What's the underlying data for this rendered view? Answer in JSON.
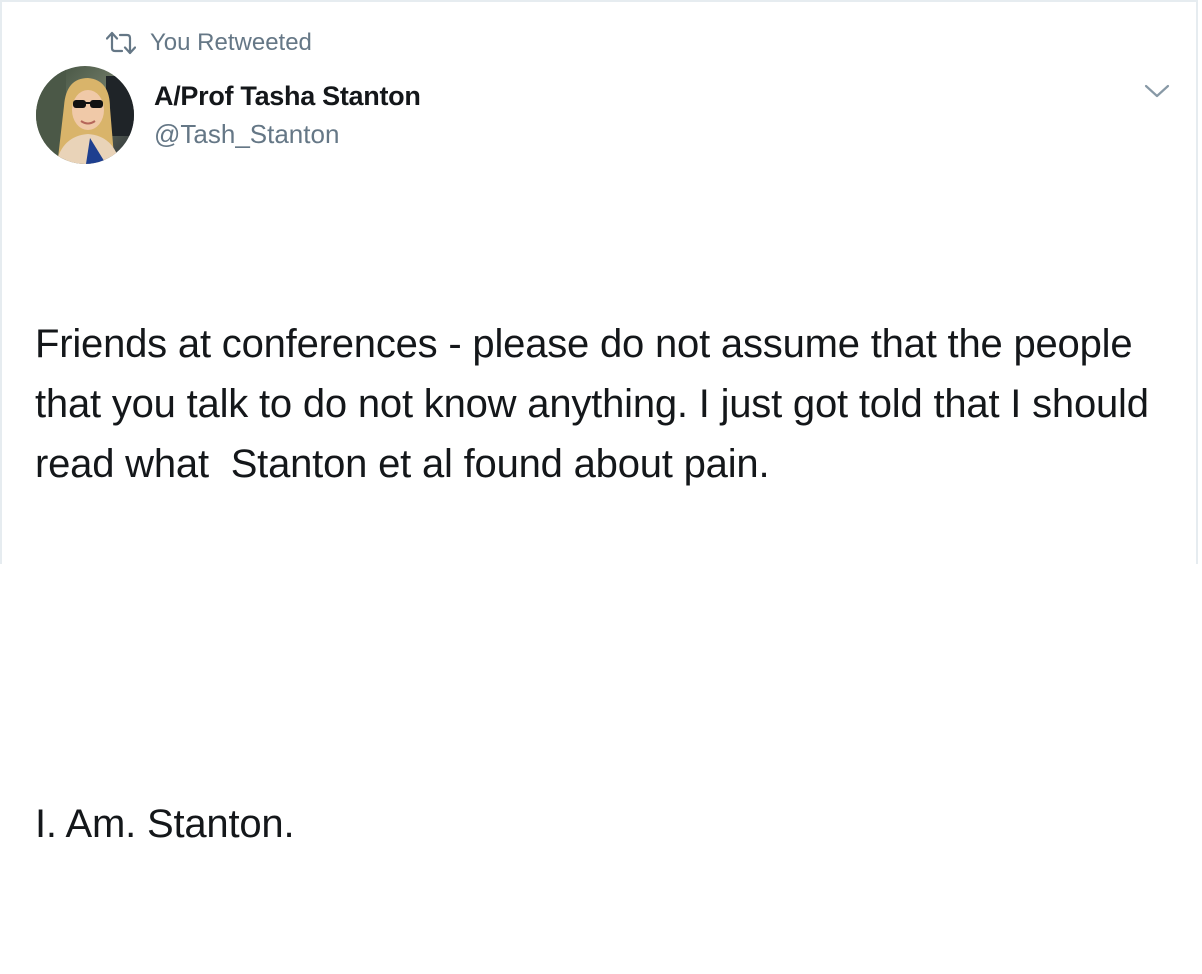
{
  "retweet": {
    "icon": "retweet-icon",
    "label": "You Retweeted"
  },
  "author": {
    "avatar_icon": "avatar",
    "display_name": "A/Prof Tasha Stanton",
    "handle": "@Tash_Stanton"
  },
  "menu": {
    "icon": "chevron-down-icon"
  },
  "tweet": {
    "paragraphs": [
      "Friends at conferences - please do not assume that the people that you talk to do not know anything. I just got told that I should read what  Stanton et al found about pain.",
      "I. Am. Stanton."
    ]
  },
  "colors": {
    "text_primary": "#14171a",
    "text_secondary": "#657786",
    "border": "#e6ecf0"
  }
}
